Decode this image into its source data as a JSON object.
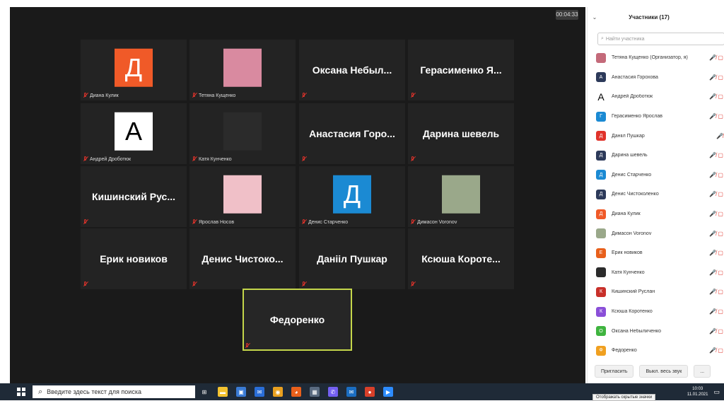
{
  "meeting": {
    "timer": "00:04:33"
  },
  "tiles": [
    {
      "display": "avatar",
      "avatar_letter": "Д",
      "avatar_color": "#f05a28",
      "label": "Диана Кулик"
    },
    {
      "display": "photo",
      "photo_color": "#d98aa0",
      "label": "Тетяна Кущенко"
    },
    {
      "display": "name",
      "name": "Оксана Небыл..."
    },
    {
      "display": "name",
      "name": "Герасименко Я..."
    },
    {
      "display": "avatar",
      "avatar_letter": "А",
      "avatar_color": "#ffffff",
      "avatar_text_color": "#000000",
      "label": "Андрей Дроботюк"
    },
    {
      "display": "photo",
      "photo_color": "#2b2b2b",
      "label": "Катя Кунченко"
    },
    {
      "display": "name",
      "name": "Анастасия Горо..."
    },
    {
      "display": "name",
      "name": "Дарина шевель"
    },
    {
      "display": "name",
      "name": "Кишинский Рус..."
    },
    {
      "display": "photo",
      "photo_color": "#f0c0c8",
      "label": "Ярослав Носов"
    },
    {
      "display": "avatar",
      "avatar_letter": "Д",
      "avatar_color": "#1b8ad3",
      "label": "Денис Старченко"
    },
    {
      "display": "photo",
      "photo_color": "#9aa88a",
      "label": "Димасон Voronov"
    },
    {
      "display": "name",
      "name": "Ерик новиков"
    },
    {
      "display": "name",
      "name": "Денис Чистоко..."
    },
    {
      "display": "name",
      "name": "Данiiл Пушкар"
    },
    {
      "display": "name",
      "name": "Ксюша Короте..."
    },
    {
      "display": "name",
      "name": "Федоренко",
      "active": true
    }
  ],
  "panel": {
    "title": "Участники (17)",
    "search_placeholder": "Найти участника",
    "participants": [
      {
        "name": "Тетяна Кущенко (Организатор, я)",
        "avatar": "photo",
        "color": "#c46a7a",
        "icons": "🎤̸ ▢"
      },
      {
        "name": "Анастасия Горохова",
        "avatar": "А",
        "color": "#2d3a5a",
        "icons": "🎤̸ ▢"
      },
      {
        "name": "Андрей Дроботюк",
        "avatar": "А",
        "color": "#ffffff",
        "text_color": "#000000",
        "icons": "🎤̸ ▢"
      },
      {
        "name": "Герасименко Ярослав",
        "avatar": "Г",
        "color": "#1b8ad3",
        "icons": "🎤̸ ▢"
      },
      {
        "name": "Данiiл Пушкар",
        "avatar": "Д",
        "color": "#e0332b",
        "icons": "🎤̸"
      },
      {
        "name": "Дарина шевель",
        "avatar": "Д",
        "color": "#2d3a5a",
        "icons": "🎤̸ ▢"
      },
      {
        "name": "Денис Старченко",
        "avatar": "Д",
        "color": "#1b8ad3",
        "icons": "🎤̸ ▢"
      },
      {
        "name": "Денис Чистоколенко",
        "avatar": "Д",
        "color": "#2d3a5a",
        "icons": "🎤̸ ▢"
      },
      {
        "name": "Диана Кулик",
        "avatar": "Д",
        "color": "#f05a28",
        "icons": "🎤̸ ▢"
      },
      {
        "name": "Димасон Voronov",
        "avatar": "photo",
        "color": "#9aa88a",
        "icons": "🎤̸ ▢"
      },
      {
        "name": "Ерик новиков",
        "avatar": "Е",
        "color": "#e8601c",
        "icons": "🎤̸ ▢"
      },
      {
        "name": "Катя Кунченко",
        "avatar": "photo",
        "color": "#2b2b2b",
        "icons": "🎤̸ ▢"
      },
      {
        "name": "Кишинский Руслан",
        "avatar": "К",
        "color": "#c8302a",
        "icons": "🎤̸ ▢"
      },
      {
        "name": "Ксюша Коротенко",
        "avatar": "К",
        "color": "#8a4fd8",
        "icons": "🎤̸ ▢"
      },
      {
        "name": "Оксана Небыличенко",
        "avatar": "О",
        "color": "#3fb43f",
        "icons": "🎤̸ ▢"
      },
      {
        "name": "Федоренко",
        "avatar": "Ф",
        "color": "#f0a020",
        "icons": "🎤̸ ▢"
      }
    ],
    "invite_label": "Пригласить",
    "mute_all_label": "Выкл. весь звук",
    "more_label": "..."
  },
  "taskbar": {
    "search_placeholder": "Введите здесь текст для поиска",
    "tooltip": "Отображать скрытые значки",
    "time": "10:03",
    "date": "11.01.2021",
    "apps": [
      {
        "icon": "task-view-icon",
        "color": "#1f2a37",
        "glyph": "⊞"
      },
      {
        "icon": "file-explorer-icon",
        "color": "#f2c230",
        "glyph": "▬"
      },
      {
        "icon": "store-icon",
        "color": "#3a7bd5",
        "glyph": "▣"
      },
      {
        "icon": "mail-icon",
        "color": "#2a6ed8",
        "glyph": "✉"
      },
      {
        "icon": "chrome-icon",
        "color": "#e8a020",
        "glyph": "◉"
      },
      {
        "icon": "firefox-icon",
        "color": "#e8601c",
        "glyph": "◕"
      },
      {
        "icon": "calculator-icon",
        "color": "#5a6b80",
        "glyph": "▦"
      },
      {
        "icon": "viber-icon",
        "color": "#7360f2",
        "glyph": "✆"
      },
      {
        "icon": "outlook-icon",
        "color": "#1b6ec2",
        "glyph": "✉"
      },
      {
        "icon": "app-red-icon",
        "color": "#d8402a",
        "glyph": "●"
      },
      {
        "icon": "zoom-icon",
        "color": "#2d8cff",
        "glyph": "▶"
      }
    ]
  }
}
